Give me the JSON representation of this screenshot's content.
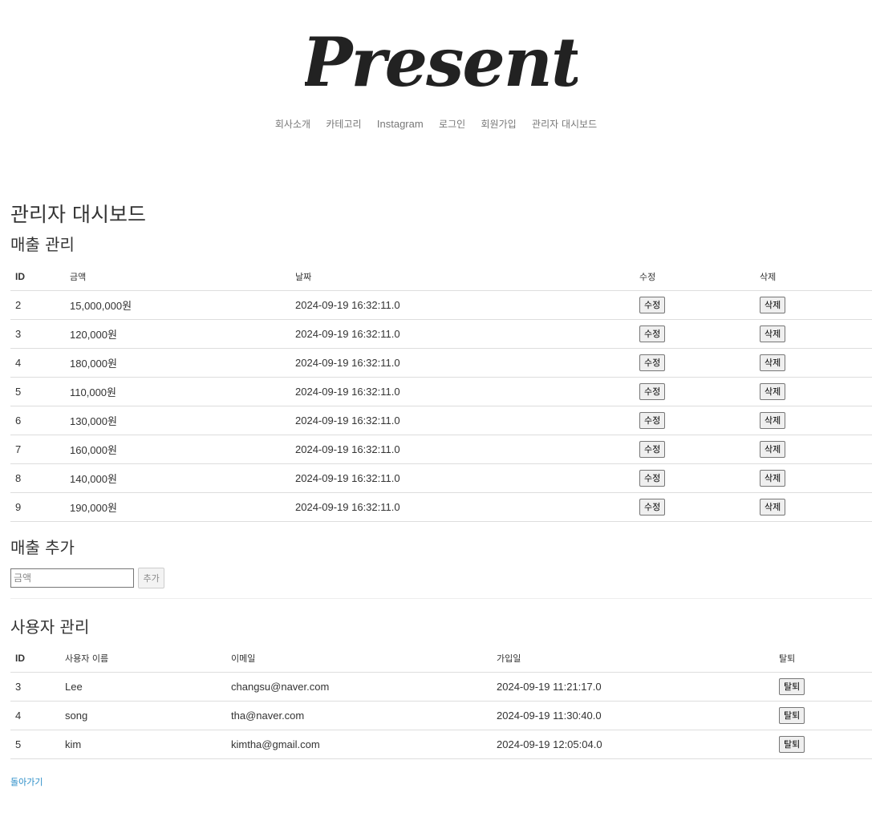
{
  "brand": {
    "logo_text": "Present"
  },
  "nav": {
    "items": [
      {
        "label": "회사소개"
      },
      {
        "label": "카테고리"
      },
      {
        "label": "Instagram"
      },
      {
        "label": "로그인"
      },
      {
        "label": "회원가입"
      },
      {
        "label": "관리자 대시보드"
      }
    ]
  },
  "page": {
    "title": "관리자 대시보드"
  },
  "sales": {
    "heading": "매출 관리",
    "columns": {
      "id": "ID",
      "amount": "금액",
      "date": "날짜",
      "edit": "수정",
      "delete": "삭제"
    },
    "edit_label": "수정",
    "delete_label": "삭제",
    "rows": [
      {
        "id": "2",
        "amount": "15,000,000원",
        "date": "2024-09-19 16:32:11.0"
      },
      {
        "id": "3",
        "amount": "120,000원",
        "date": "2024-09-19 16:32:11.0"
      },
      {
        "id": "4",
        "amount": "180,000원",
        "date": "2024-09-19 16:32:11.0"
      },
      {
        "id": "5",
        "amount": "110,000원",
        "date": "2024-09-19 16:32:11.0"
      },
      {
        "id": "6",
        "amount": "130,000원",
        "date": "2024-09-19 16:32:11.0"
      },
      {
        "id": "7",
        "amount": "160,000원",
        "date": "2024-09-19 16:32:11.0"
      },
      {
        "id": "8",
        "amount": "140,000원",
        "date": "2024-09-19 16:32:11.0"
      },
      {
        "id": "9",
        "amount": "190,000원",
        "date": "2024-09-19 16:32:11.0"
      }
    ]
  },
  "add_sales": {
    "heading": "매출 추가",
    "amount_placeholder": "금액",
    "amount_value": "",
    "add_label": "추가"
  },
  "users": {
    "heading": "사용자 관리",
    "columns": {
      "id": "ID",
      "name": "사용자 이름",
      "email": "이메일",
      "joined": "가입일",
      "withdraw": "탈퇴"
    },
    "withdraw_label": "탈퇴",
    "rows": [
      {
        "id": "3",
        "name": "Lee",
        "email": "changsu@naver.com",
        "joined": "2024-09-19 11:21:17.0"
      },
      {
        "id": "4",
        "name": "song",
        "email": "tha@naver.com",
        "joined": "2024-09-19 11:30:40.0"
      },
      {
        "id": "5",
        "name": "kim",
        "email": "kimtha@gmail.com",
        "joined": "2024-09-19 12:05:04.0"
      }
    ]
  },
  "footer": {
    "back_label": "돌아가기"
  },
  "colors": {
    "link": "#2a8dc8",
    "nav_text": "#777777",
    "row_border": "#dddddd"
  }
}
